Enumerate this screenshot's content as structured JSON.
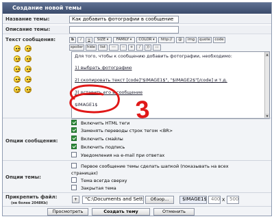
{
  "window": {
    "title": "Создание новой темы"
  },
  "labels": {
    "topic_name": "Название темы:",
    "topic_desc": "Описание темы:",
    "message_text": "Текст сообщения:",
    "message_options": "Опции сообщения:",
    "topic_options": "Опции темы:",
    "attach_file": "Прикрепить файл:",
    "attach_note": "(не более 2048Kb)"
  },
  "fields": {
    "topic_name_value": "Как добавить фотографии в сообщение",
    "topic_desc_value": ""
  },
  "toolbar": {
    "row1": [
      "b",
      "i",
      "u",
      "SIZE",
      "FAMILY",
      "COLOR",
      "http://",
      "@",
      "img",
      "quote",
      "code"
    ],
    "row2": [
      "spoiler",
      "hide",
      "list",
      "---",
      "--",
      "+",
      "/",
      "))",
      ":::"
    ]
  },
  "editor": {
    "line1": "Для того, чтобы к сообщению добавить фотографии, необходимо:",
    "line2": "1) выбрать фотографию",
    "line3": "2) скопировать текст [code]\"$IMAGE1$\", \"$IMAGE2$\"[/code] и т.д.",
    "line4": "3) вставить его в сообщение",
    "line5": "$IMAGE1$"
  },
  "annotation": {
    "digit": "3"
  },
  "message_options": [
    {
      "label": "Включить HTML теги",
      "checked": true
    },
    {
      "label": "Заменять переводы строк тегом <BR>",
      "checked": true
    },
    {
      "label": "Включить смайлы",
      "checked": true
    },
    {
      "label": "Включить подпись",
      "checked": true
    },
    {
      "label": "Уведомления на e-mail при ответах",
      "checked": false
    }
  ],
  "topic_options": [
    {
      "label": "Первое сообщение темы сделать шапкой (показывать на всех",
      "checked": false
    },
    {
      "label": "страницах)",
      "checked": false
    },
    {
      "label": "Тема всегда сверху",
      "checked": false
    },
    {
      "label": "Закрытая тема",
      "checked": false
    }
  ],
  "attach": {
    "plus_label": "+",
    "path_value": "\"C:\\Documents and Setti",
    "browse_label": "Обзор...",
    "image_tag": "$IMAGE1$",
    "width": "400",
    "height": "500",
    "x_sep": "X"
  },
  "buttons": {
    "preview": "Просмотреть",
    "create": "Создать тему",
    "cancel": "Отменить"
  },
  "colors": {
    "title_bar": "#4a5a7b",
    "annotation_red": "#e01818",
    "checkbox_on": "#2e8b3a"
  }
}
